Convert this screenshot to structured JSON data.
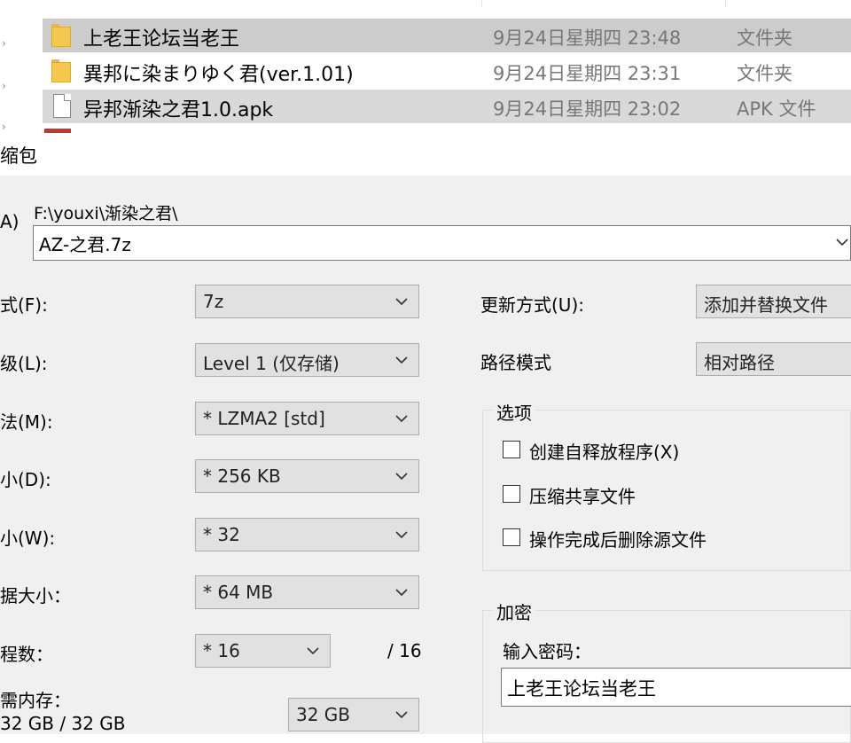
{
  "explorer": {
    "files": [
      {
        "name": "上老王论坛当老王",
        "date": "9月24日星期四 23:48",
        "type": "文件夹",
        "icon": "folder-icon",
        "selected": true
      },
      {
        "name": "異邦に染まりゆく君(ver.1.01)",
        "date": "9月24日星期四 23:31",
        "type": "文件夹",
        "icon": "folder-icon",
        "selected": false
      },
      {
        "name": "异邦渐染之君1.0.apk",
        "date": "9月24日星期四 23:02",
        "type": "APK 文件",
        "icon": "file-icon",
        "selected": true
      }
    ]
  },
  "dialog": {
    "title": "缩包",
    "archive_label": "A)",
    "archive_path": "F:\\youxi\\渐染之君\\",
    "archive_name": "AZ-之君.7z",
    "left": {
      "format": {
        "label": "式(F):",
        "value": "7z"
      },
      "level": {
        "label": "级(L):",
        "value": "Level 1 (仅存储)"
      },
      "method": {
        "label": "法(M):",
        "value": "*  LZMA2 [std]"
      },
      "dict": {
        "label": "小(D):",
        "value": "*  256 KB"
      },
      "word": {
        "label": "小(W):",
        "value": "*  32"
      },
      "block": {
        "label": "据大小：",
        "value": "*  64 MB"
      },
      "threads": {
        "label": "程数：",
        "value": "*  16",
        "max": "/ 16"
      },
      "memory": {
        "label": "需内存：",
        "sub": "32 GB / 32 GB",
        "value": "32 GB"
      }
    },
    "right": {
      "update_mode": {
        "label": "更新方式(U):",
        "value": "添加并替换文件"
      },
      "path_mode": {
        "label": "路径模式",
        "value": "相对路径"
      },
      "options": {
        "title": "选项",
        "items": [
          "创建自释放程序(X)",
          "压缩共享文件",
          "操作完成后删除源文件"
        ]
      },
      "encryption": {
        "title": "加密",
        "password_label": "输入密码：",
        "password_value": "上老王论坛当老王"
      }
    }
  },
  "colors": {
    "selected_row": "#cccccc",
    "dialog_bg": "#f0f0f0",
    "combo_bg": "#e1e1e1"
  }
}
